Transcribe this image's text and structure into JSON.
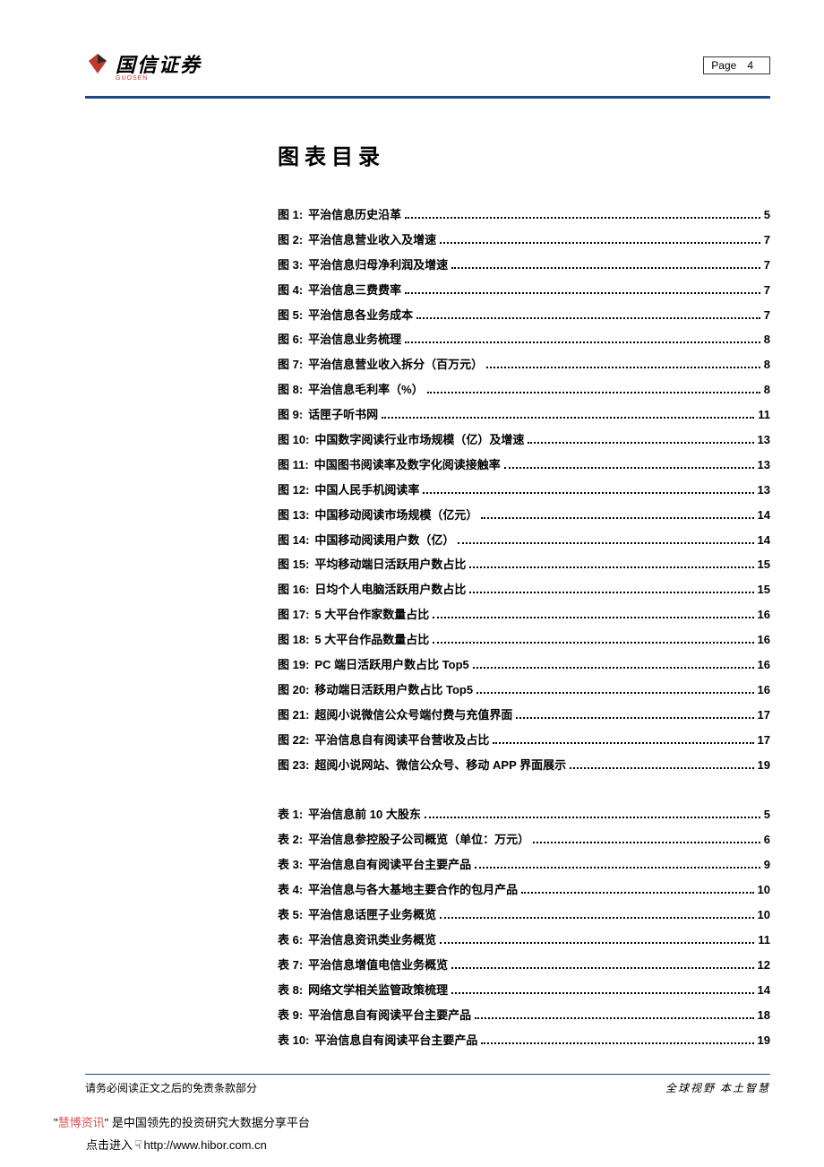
{
  "header": {
    "brand": "国信证券",
    "brand_sub": "GUOSEN",
    "page_label": "Page",
    "page_num": "4"
  },
  "toc": {
    "title": "图表目录",
    "figures": [
      {
        "label": "图 1:",
        "text": "平治信息历史沿革",
        "page": "5"
      },
      {
        "label": "图 2:",
        "text": "平治信息营业收入及增速",
        "page": "7"
      },
      {
        "label": "图 3:",
        "text": "平治信息归母净利润及增速",
        "page": "7"
      },
      {
        "label": "图 4:",
        "text": "平治信息三费费率",
        "page": "7"
      },
      {
        "label": "图 5:",
        "text": "平治信息各业务成本",
        "page": "7"
      },
      {
        "label": "图 6:",
        "text": "平治信息业务梳理",
        "page": "8"
      },
      {
        "label": "图 7:",
        "text": "平治信息营业收入拆分（百万元）",
        "page": "8"
      },
      {
        "label": "图 8:",
        "text": "平治信息毛利率（%）",
        "page": "8"
      },
      {
        "label": "图 9:",
        "text": "话匣子听书网",
        "page": "11"
      },
      {
        "label": "图 10:",
        "text": "中国数字阅读行业市场规模（亿）及增速",
        "page": "13"
      },
      {
        "label": "图 11:",
        "text": "中国图书阅读率及数字化阅读接触率",
        "page": "13"
      },
      {
        "label": "图 12:",
        "text": "中国人民手机阅读率",
        "page": "13"
      },
      {
        "label": "图 13:",
        "text": "中国移动阅读市场规模（亿元）",
        "page": "14"
      },
      {
        "label": "图 14:",
        "text": "中国移动阅读用户数（亿）",
        "page": "14"
      },
      {
        "label": "图 15:",
        "text": "平均移动端日活跃用户数占比",
        "page": "15"
      },
      {
        "label": "图 16:",
        "text": "日均个人电脑活跃用户数占比",
        "page": "15"
      },
      {
        "label": "图 17:",
        "text": "5 大平台作家数量占比",
        "page": "16"
      },
      {
        "label": "图 18:",
        "text": "5 大平台作品数量占比",
        "page": "16"
      },
      {
        "label": "图 19:",
        "text": "PC 端日活跃用户数占比 Top5",
        "page": "16"
      },
      {
        "label": "图 20:",
        "text": "移动端日活跃用户数占比 Top5",
        "page": "16"
      },
      {
        "label": "图 21:",
        "text": "超阅小说微信公众号端付费与充值界面",
        "page": "17"
      },
      {
        "label": "图 22:",
        "text": "平治信息自有阅读平台营收及占比",
        "page": "17"
      },
      {
        "label": "图 23:",
        "text": "超阅小说网站、微信公众号、移动 APP 界面展示",
        "page": "19"
      }
    ],
    "tables": [
      {
        "label": "表 1:",
        "text": "平治信息前 10 大股东",
        "page": "5"
      },
      {
        "label": "表 2:",
        "text": "平治信息参控股子公司概览（单位：万元）",
        "page": "6"
      },
      {
        "label": "表 3:",
        "text": "平治信息自有阅读平台主要产品",
        "page": "9"
      },
      {
        "label": "表 4:",
        "text": "平治信息与各大基地主要合作的包月产品",
        "page": "10"
      },
      {
        "label": "表 5:",
        "text": "平治信息话匣子业务概览",
        "page": "10"
      },
      {
        "label": "表 6:",
        "text": "平治信息资讯类业务概览",
        "page": "11"
      },
      {
        "label": "表 7:",
        "text": "平治信息增值电信业务概览",
        "page": "12"
      },
      {
        "label": "表 8:",
        "text": "网络文学相关监管政策梳理",
        "page": "14"
      },
      {
        "label": "表 9:",
        "text": "平治信息自有阅读平台主要产品",
        "page": "18"
      },
      {
        "label": "表 10:",
        "text": "平治信息自有阅读平台主要产品",
        "page": "19"
      }
    ]
  },
  "footer": {
    "left": "请务必阅读正文之后的免责条款部分",
    "right": "全球视野  本土智慧"
  },
  "promo": {
    "quote_open": "\"",
    "brand": "慧博资讯",
    "quote_close": "\"",
    "tail": " 是中国领先的投资研究大数据分享平台",
    "link_prefix": "点击进入",
    "url": "http://www.hibor.com.cn"
  }
}
